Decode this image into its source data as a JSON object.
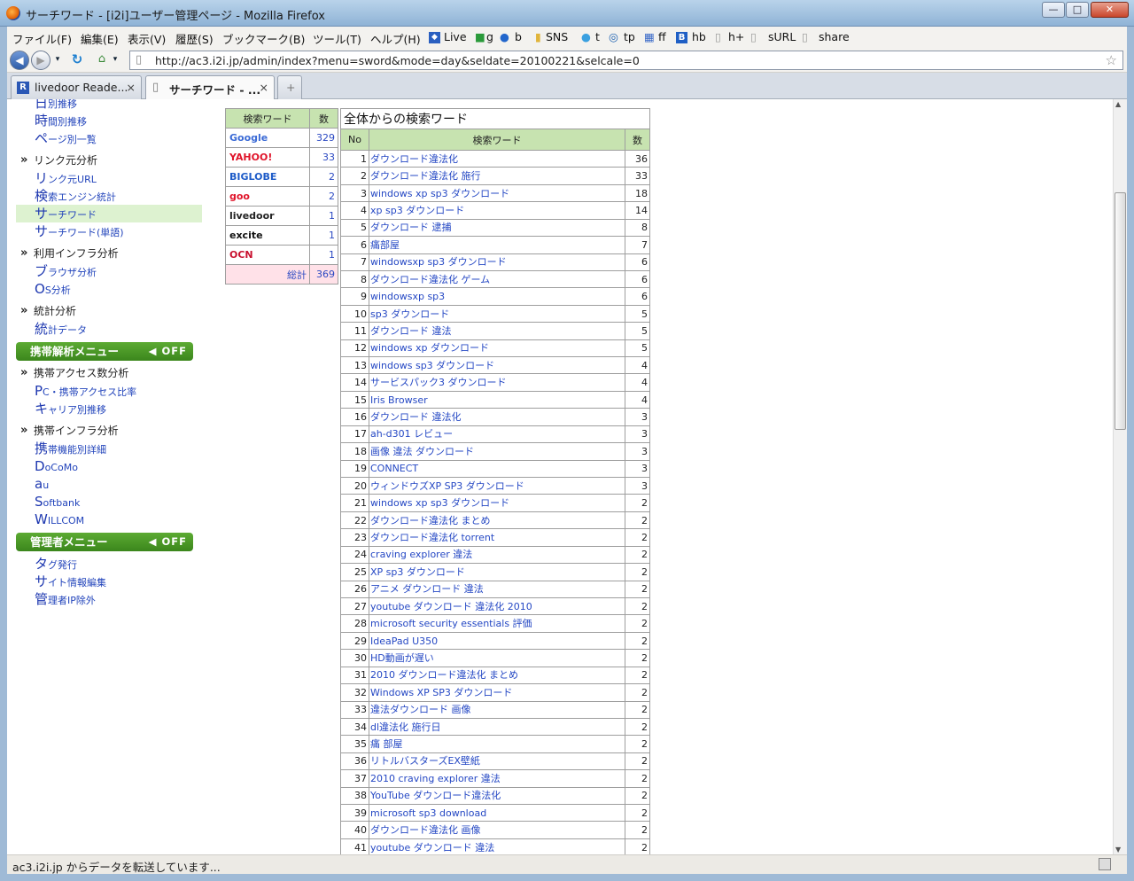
{
  "window": {
    "title": "サーチワード - [i2i]ユーザー管理ページ - Mozilla Firefox",
    "min": "—",
    "max": "□",
    "close": "✕"
  },
  "menu": {
    "file": "ファイル(F)",
    "edit": "編集(E)",
    "view": "表示(V)",
    "history": "履歴(S)",
    "bookmarks": "ブックマーク(B)",
    "tools": "ツール(T)",
    "help": "ヘルプ(H)",
    "bm": [
      "Live",
      "g",
      "b",
      "SNS",
      "t",
      "tp",
      "ff",
      "hb",
      "h+",
      "sURL",
      "share"
    ]
  },
  "nav": {
    "url": "http://ac3.i2i.jp/admin/index?menu=sword&mode=day&seldate=20100221&selcale=0"
  },
  "tabs": [
    {
      "label": "livedoor Reade...",
      "close": "×"
    },
    {
      "label": "サーチワード - ...",
      "close": "×"
    },
    {
      "label": "+"
    }
  ],
  "status": {
    "text": "ac3.i2i.jp からデータを転送しています..."
  },
  "sidebar": {
    "items1": [
      {
        "big": "日",
        "rest": "別推移"
      },
      {
        "big": "時",
        "rest": "間別推移"
      },
      {
        "big": "ペ",
        "rest": "ージ別一覧"
      }
    ],
    "sec_link": "リンク元分析",
    "items2": [
      {
        "big": "リ",
        "rest": "ンク元URL"
      },
      {
        "big": "検",
        "rest": "索エンジン統計"
      },
      {
        "big": "サ",
        "rest": "ーチワード"
      },
      {
        "big": "サ",
        "rest": "ーチワード(単語)"
      }
    ],
    "sec_infra": "利用インフラ分析",
    "items3": [
      {
        "big": "ブ",
        "rest": "ラウザ分析"
      },
      {
        "big": "O",
        "rest": "S分析"
      }
    ],
    "sec_stats": "統計分析",
    "items4": [
      {
        "big": "統",
        "rest": "計データ"
      }
    ],
    "mobile_menu": "携帯解析メニュー",
    "mobile_off": "OFF",
    "sec_maccess": "携帯アクセス数分析",
    "items5": [
      {
        "big": "P",
        "rest": "C・携帯アクセス比率"
      },
      {
        "big": "キ",
        "rest": "ャリア別推移"
      }
    ],
    "sec_minfra": "携帯インフラ分析",
    "items6": [
      {
        "big": "携",
        "rest": "帯機能別詳細"
      },
      {
        "big": "D",
        "rest": "oCoMo"
      },
      {
        "big": "a",
        "rest": "u"
      },
      {
        "big": "S",
        "rest": "oftbank"
      },
      {
        "big": "W",
        "rest": "ILLCOM"
      }
    ],
    "admin_menu": "管理者メニュー",
    "admin_off": "OFF",
    "items7": [
      {
        "big": "タ",
        "rest": "グ発行"
      },
      {
        "big": "サ",
        "rest": "イト情報編集"
      },
      {
        "big": "管",
        "rest": "理者IP除外"
      }
    ]
  },
  "engines": {
    "h_word": "検索ワード",
    "h_count": "数",
    "rows": [
      {
        "name": "Google",
        "color": "#3a6ad6",
        "count": "329"
      },
      {
        "name": "YAHOO!",
        "color": "#e0142a",
        "count": "33"
      },
      {
        "name": "BIGLOBE",
        "color": "#1d5bc8",
        "count": "2"
      },
      {
        "name": "goo",
        "color": "#e0142a",
        "count": "2"
      },
      {
        "name": "livedoor",
        "color": "#222222",
        "count": "1"
      },
      {
        "name": "excite",
        "color": "#111111",
        "count": "1"
      },
      {
        "name": "OCN",
        "color": "#c8102e",
        "count": "1"
      }
    ],
    "total_label": "総計",
    "total": "369"
  },
  "words": {
    "caption": "全体からの検索ワード",
    "h_no": "No",
    "h_word": "検索ワード",
    "h_count": "数",
    "rows": [
      [
        "1",
        "ダウンロード違法化",
        "36"
      ],
      [
        "2",
        "ダウンロード違法化 施行",
        "33"
      ],
      [
        "3",
        "windows xp sp3 ダウンロード",
        "18"
      ],
      [
        "4",
        "xp sp3 ダウンロード",
        "14"
      ],
      [
        "5",
        "ダウンロード 逮捕",
        "8"
      ],
      [
        "6",
        "痛部屋",
        "7"
      ],
      [
        "7",
        "windowsxp sp3 ダウンロード",
        "6"
      ],
      [
        "8",
        "ダウンロード違法化 ゲーム",
        "6"
      ],
      [
        "9",
        "windowsxp sp3",
        "6"
      ],
      [
        "10",
        "sp3 ダウンロード",
        "5"
      ],
      [
        "11",
        "ダウンロード 違法",
        "5"
      ],
      [
        "12",
        "windows xp ダウンロード",
        "5"
      ],
      [
        "13",
        "windows sp3 ダウンロード",
        "4"
      ],
      [
        "14",
        "サービスパック3 ダウンロード",
        "4"
      ],
      [
        "15",
        "Iris Browser",
        "4"
      ],
      [
        "16",
        "ダウンロード 違法化",
        "3"
      ],
      [
        "17",
        "ah-d301 レビュー",
        "3"
      ],
      [
        "18",
        "画像 違法 ダウンロード",
        "3"
      ],
      [
        "19",
        "CONNECT",
        "3"
      ],
      [
        "20",
        "ウィンドウズXP SP3 ダウンロード",
        "3"
      ],
      [
        "21",
        "windows xp sp3 ダウンロード",
        "2"
      ],
      [
        "22",
        "ダウンロード違法化 まとめ",
        "2"
      ],
      [
        "23",
        "ダウンロード違法化 torrent",
        "2"
      ],
      [
        "24",
        "craving explorer 違法",
        "2"
      ],
      [
        "25",
        "XP sp3 ダウンロード",
        "2"
      ],
      [
        "26",
        "アニメ ダウンロード 違法",
        "2"
      ],
      [
        "27",
        "youtube ダウンロード 違法化 2010",
        "2"
      ],
      [
        "28",
        "microsoft security essentials 評価",
        "2"
      ],
      [
        "29",
        "IdeaPad U350",
        "2"
      ],
      [
        "30",
        "HD動画が遅い",
        "2"
      ],
      [
        "31",
        "2010 ダウンロード違法化 まとめ",
        "2"
      ],
      [
        "32",
        "Windows XP SP3 ダウンロード",
        "2"
      ],
      [
        "33",
        "違法ダウンロード 画像",
        "2"
      ],
      [
        "34",
        "dl違法化 施行日",
        "2"
      ],
      [
        "35",
        "痛 部屋",
        "2"
      ],
      [
        "36",
        "リトルバスターズEX壁紙",
        "2"
      ],
      [
        "37",
        "2010 craving explorer 違法",
        "2"
      ],
      [
        "38",
        "YouTube ダウンロード違法化",
        "2"
      ],
      [
        "39",
        "microsoft sp3 download",
        "2"
      ],
      [
        "40",
        "ダウンロード違法化 画像",
        "2"
      ],
      [
        "41",
        "youtube ダウンロード 違法",
        "2"
      ]
    ]
  }
}
